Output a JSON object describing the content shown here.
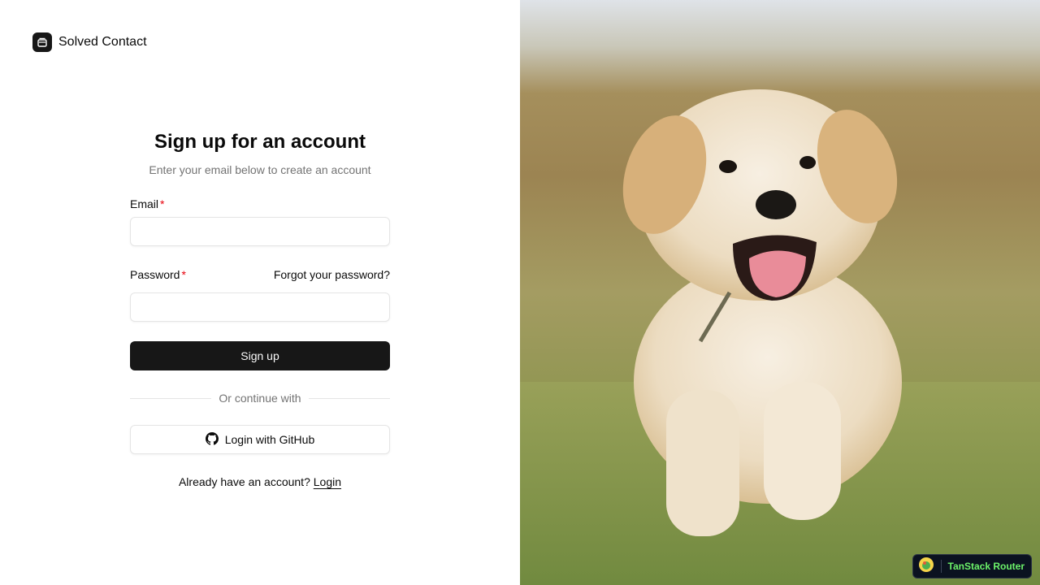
{
  "brand": {
    "name": "Solved Contact",
    "icon": "database-icon"
  },
  "form": {
    "title": "Sign up for an account",
    "subtitle": "Enter your email below to create an account",
    "email": {
      "label": "Email",
      "required_mark": "*",
      "value": "",
      "placeholder": ""
    },
    "password": {
      "label": "Password",
      "required_mark": "*",
      "value": "",
      "placeholder": ""
    },
    "forgot_password": "Forgot your password?",
    "submit_label": "Sign up",
    "divider_text": "Or continue with",
    "github_label": "Login with GitHub",
    "footer_prefix": "Already have an account?",
    "footer_link": "Login"
  },
  "hero": {
    "subject": "puppy-photo"
  },
  "devtools": {
    "label": "TanStack Router",
    "icon": "tanstack-logo-icon"
  },
  "colors": {
    "primary": "#171717",
    "required": "#e7000b",
    "muted": "#737373",
    "devtools_text": "#6cf26a"
  }
}
